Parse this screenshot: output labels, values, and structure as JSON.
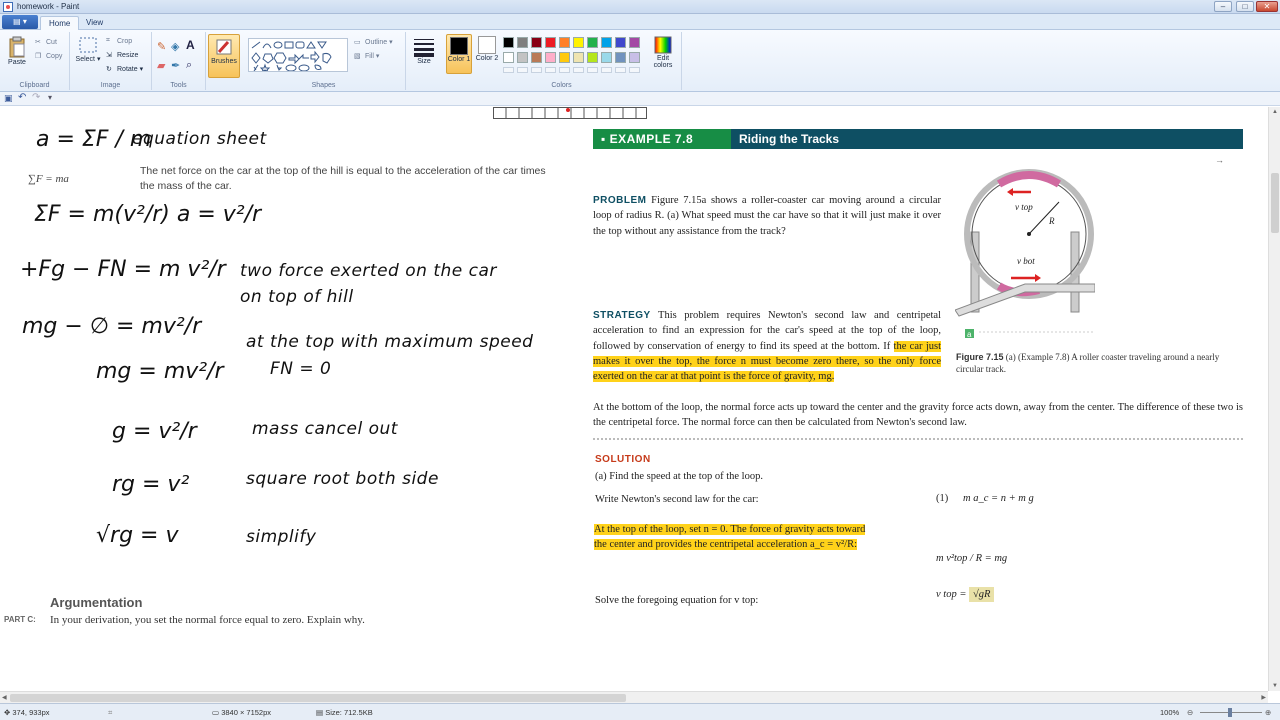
{
  "window": {
    "title": "homework - Paint"
  },
  "tabs": [
    "Home",
    "View"
  ],
  "ribbon": {
    "clipboard": {
      "paste": "Paste",
      "cut": "Cut",
      "copy": "Copy",
      "label": "Clipboard"
    },
    "image": {
      "select": "Select",
      "crop": "Crop",
      "resize": "Resize",
      "rotate": "Rotate",
      "label": "Image"
    },
    "tools": {
      "label": "Tools"
    },
    "brushes": {
      "label": "Brushes"
    },
    "shapes": {
      "outline": "Outline",
      "fill": "Fill",
      "label": "Shapes"
    },
    "size": {
      "label": "Size"
    },
    "colors": {
      "color1": "Color 1",
      "color2": "Color 2",
      "edit": "Edit colors",
      "label": "Colors",
      "color1_value": "#000000",
      "color2_value": "#ffffff",
      "palette": [
        "#000000",
        "#7f7f7f",
        "#880015",
        "#ed1c24",
        "#ff7f27",
        "#fff200",
        "#22b14c",
        "#00a2e8",
        "#3f48cc",
        "#a349a4",
        "#ffffff",
        "#c3c3c3",
        "#b97a57",
        "#ffaec9",
        "#ffc90e",
        "#efe4b0",
        "#b5e61d",
        "#99d9ea",
        "#7092be",
        "#c8bfe7"
      ]
    }
  },
  "handwriting": {
    "eq1": "a = ΣF / m",
    "eq1_note": "equation sheet",
    "eq2": "ΣF = m(v²/r)   a = v²/r",
    "eq3": "+Fg − FN = m v²/r",
    "eq3_note": "two force exerted on the car",
    "eq3_note2": "on top of hill",
    "eq4": "mg − ∅ = mv²/r",
    "eq4_note": "at the top with maximum speed",
    "eq4_note2": "FN = 0",
    "eq5": "mg = mv²/r",
    "eq6": "g = v²/r",
    "eq6_note": "mass cancel out",
    "eq7": "rg = v²",
    "eq7_note": "square root both side",
    "eq8": "√rg = v",
    "eq8_note": "simplify"
  },
  "printed": {
    "sum_f": "∑F = ma",
    "net_force_text": "The net force on the car at the top of the hill is equal to the acceleration of the car times the mass of the car."
  },
  "textbook": {
    "example_label": "EXAMPLE 7.8",
    "example_title": "Riding the Tracks",
    "problem_label": "PROBLEM",
    "problem_text": "Figure 7.15a shows a roller-coaster car moving around a circular loop of radius R. (a) What speed must the car have so that it will just make it over the top without any assistance from the track?",
    "strategy_label": "STRATEGY",
    "strategy_pre": "This problem requires Newton's second law and centripetal acceleration to find an expression for the car's speed at the top of the loop, followed by conservation of energy to find its speed at the bottom. If",
    "strategy_hl": "the car just makes it over the top, the force n must become zero there, so the only force exerted on the car at that point is the force of gravity, mg.",
    "strategy_post": "At the bottom of the loop, the normal force acts up toward the center and the gravity force acts down, away from the center. The difference of these two is the centripetal force. The normal force can then be calculated from Newton's second law.",
    "figure_label": "Figure 7.15",
    "figure_caption": "(a) (Example 7.8) A roller coaster traveling around a nearly circular track.",
    "fig_vtop": "v top",
    "fig_vbot": "v bot",
    "fig_r": "R",
    "fig_a": "a",
    "solution_label": "SOLUTION",
    "sol_a": "(a) Find the speed at the top of the loop.",
    "sol_newton": "Write Newton's second law for the car:",
    "eq_1_num": "(1)",
    "eq_1": "m a_c = n + m g",
    "sol_top_hl": "At the top of the loop, set n = 0. The force of gravity acts toward the center and provides the centripetal acceleration a_c = v²/R:",
    "eq_2": "m v²top / R = mg",
    "sol_solve": "Solve the foregoing equation for v top:",
    "eq_3_left": "v top =",
    "eq_3_box": "√gR"
  },
  "argumentation": {
    "title": "Argumentation",
    "part": "PART C:",
    "question": "In your derivation, you set the normal force equal to zero. Explain why."
  },
  "statusbar": {
    "cursor": "374, 933px",
    "dimensions": "3840 × 7152px",
    "size": "Size: 712.5KB",
    "zoom": "100%"
  }
}
